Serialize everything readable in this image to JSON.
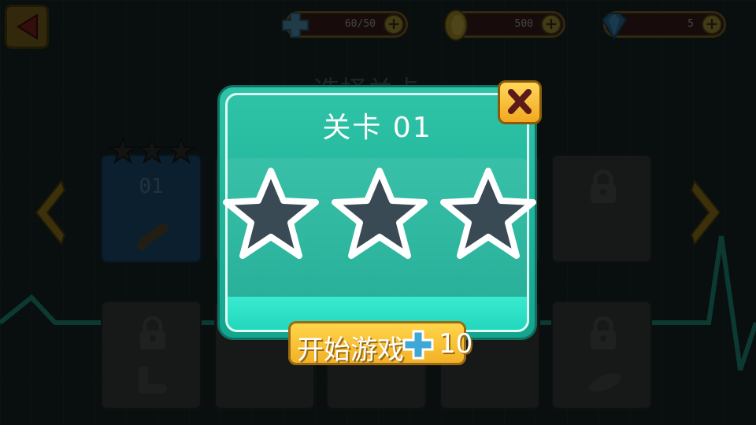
{
  "screen": {
    "title": "选择关卡"
  },
  "hud": {
    "energy": {
      "value": "60/50",
      "icon": "plus-cross-icon",
      "color": "#3fa7d6"
    },
    "coins": {
      "value": "500",
      "icon": "coin-icon",
      "color": "#e3b021"
    },
    "gems": {
      "value": "5",
      "icon": "diamond-icon",
      "color": "#2f8fd6"
    }
  },
  "level_grid": {
    "tiles": [
      {
        "label": "01",
        "state": "unlocked",
        "stars": 3,
        "item_icon": "thermometer-icon"
      },
      {
        "state": "locked"
      },
      {
        "state": "locked"
      },
      {
        "state": "locked"
      },
      {
        "state": "locked"
      },
      {
        "state": "locked",
        "item_icon": "boot-icon"
      },
      {
        "state": "locked"
      },
      {
        "state": "locked"
      },
      {
        "state": "locked"
      },
      {
        "state": "locked",
        "item_icon": "bottle-icon"
      }
    ]
  },
  "dialog": {
    "title": "关卡 01",
    "stars_earned": 0,
    "stars_total": 3,
    "start_button": {
      "label": "开始游戏",
      "cost": "10",
      "cost_icon": "plus-cross-icon"
    },
    "close_icon": "close-icon"
  },
  "colors": {
    "accent_teal": "#1fbfa6",
    "button_gold": "#f7c233",
    "energy_blue": "#3fa7d6"
  }
}
